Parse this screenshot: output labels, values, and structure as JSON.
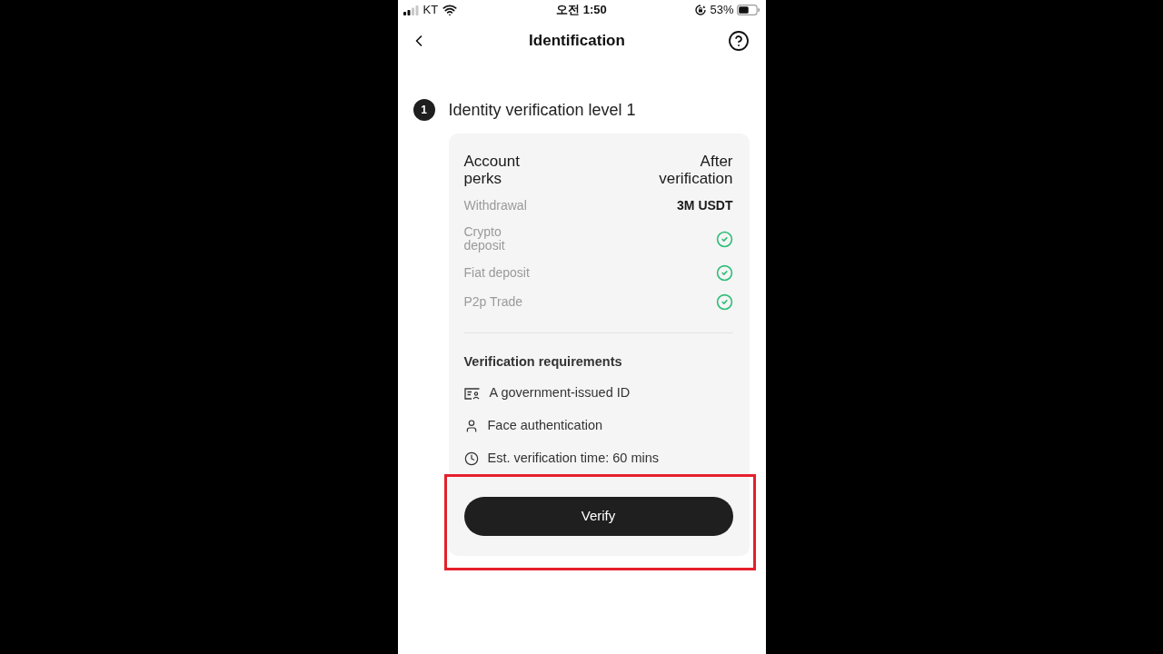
{
  "status_bar": {
    "carrier": "KT",
    "time": "오전 1:50",
    "battery": "53%"
  },
  "header": {
    "title": "Identification"
  },
  "step": {
    "number": "1",
    "title": "Identity verification level 1"
  },
  "perks": {
    "heading": "Account perks",
    "column_heading": "After verification",
    "rows": [
      {
        "label": "Withdrawal",
        "kind": "text",
        "value": "3M USDT"
      },
      {
        "label": "Crypto deposit",
        "kind": "check"
      },
      {
        "label": "Fiat deposit",
        "kind": "check"
      },
      {
        "label": "P2p Trade",
        "kind": "check"
      }
    ]
  },
  "requirements": {
    "heading": "Verification requirements",
    "items": [
      {
        "kind": "id",
        "text": "A government-issued ID"
      },
      {
        "kind": "face",
        "text": "Face authentication"
      },
      {
        "kind": "time",
        "text": "Est. verification time: 60 mins"
      }
    ]
  },
  "verify_button": {
    "label": "Verify",
    "highlighted": true
  }
}
